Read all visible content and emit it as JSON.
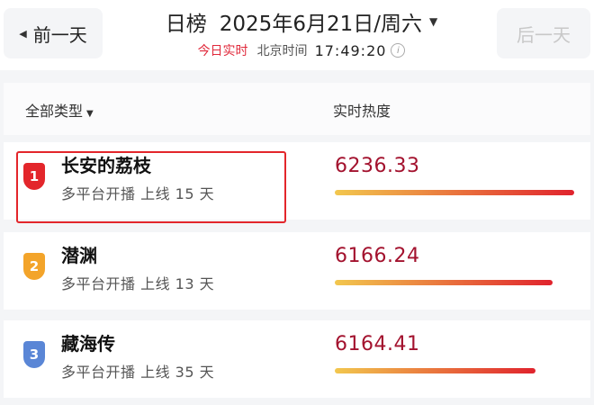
{
  "header": {
    "prev_label": "前一天",
    "next_label": "后一天",
    "title": "日榜",
    "date": "2025年6月21日/周六",
    "realtime_label": "今日实时",
    "beijing_label": "北京时间",
    "time": "17:49:20",
    "info_icon": "i"
  },
  "table": {
    "type_filter": "全部类型",
    "heat_column": "实时热度"
  },
  "rows": [
    {
      "rank": "1",
      "name": "长安的荔枝",
      "meta": "多平台开播 上线 15 天",
      "heat": "6236.33",
      "badge_color": "#e3262b",
      "bar_fraction": 1.0
    },
    {
      "rank": "2",
      "name": "潜渊",
      "meta": "多平台开播 上线 13 天",
      "heat": "6166.24",
      "badge_color": "#f3a42a",
      "bar_fraction": 0.91
    },
    {
      "rank": "3",
      "name": "藏海传",
      "meta": "多平台开播 上线 35 天",
      "heat": "6164.41",
      "badge_color": "#5a86d6",
      "bar_fraction": 0.84
    }
  ],
  "colors": {
    "accent_red": "#e0293b",
    "heat_text": "#a3122e",
    "bar_start": "#f2c74e",
    "bar_end": "#e0232d"
  }
}
